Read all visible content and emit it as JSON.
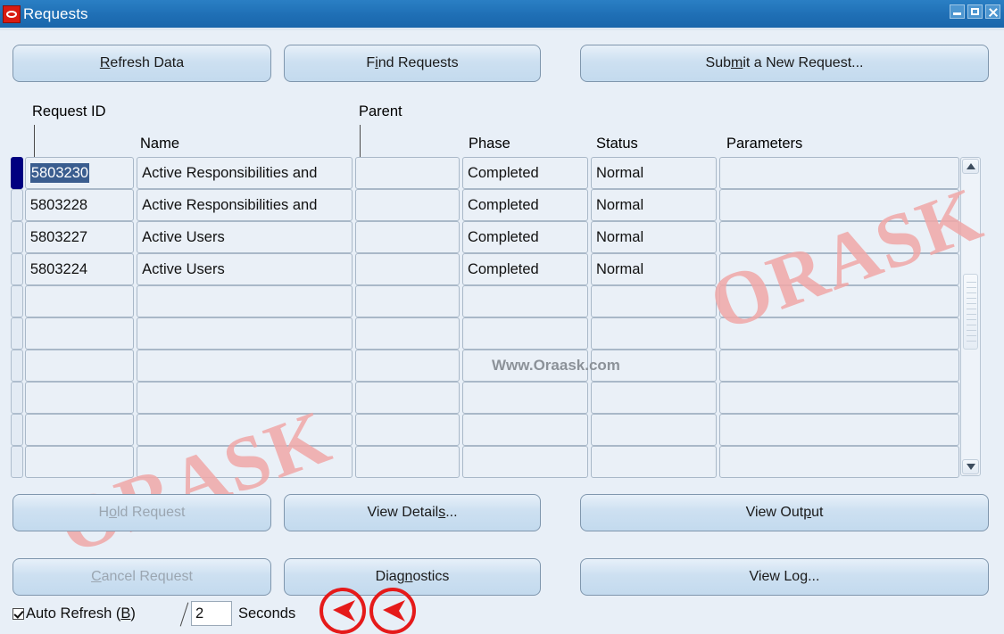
{
  "window": {
    "title": "Requests",
    "icon": "oracle-logo-icon",
    "controls": {
      "minimize": "minimize-icon",
      "maximize": "maximize-icon",
      "close": "close-icon"
    }
  },
  "toolbar": {
    "refresh_data": {
      "pre": "",
      "mnemonic": "R",
      "post": "efresh Data"
    },
    "find_requests": {
      "pre": "F",
      "mnemonic": "i",
      "post": "nd Requests"
    },
    "submit_new_request": {
      "pre": "Sub",
      "mnemonic": "m",
      "post": "it a New Request..."
    }
  },
  "grid": {
    "headers": {
      "request_id": "Request ID",
      "name": "Name",
      "parent": "Parent",
      "phase": "Phase",
      "status": "Status",
      "parameters": "Parameters"
    },
    "rows": [
      {
        "selected": true,
        "request_id": "5803230",
        "name": "Active Responsibilities and",
        "parent": "",
        "phase": "Completed",
        "status": "Normal",
        "parameters": ""
      },
      {
        "selected": false,
        "request_id": "5803228",
        "name": "Active Responsibilities and",
        "parent": "",
        "phase": "Completed",
        "status": "Normal",
        "parameters": ""
      },
      {
        "selected": false,
        "request_id": "5803227",
        "name": "Active Users",
        "parent": "",
        "phase": "Completed",
        "status": "Normal",
        "parameters": ""
      },
      {
        "selected": false,
        "request_id": "5803224",
        "name": "Active Users",
        "parent": "",
        "phase": "Completed",
        "status": "Normal",
        "parameters": ""
      },
      {
        "selected": false,
        "request_id": "",
        "name": "",
        "parent": "",
        "phase": "",
        "status": "",
        "parameters": ""
      },
      {
        "selected": false,
        "request_id": "",
        "name": "",
        "parent": "",
        "phase": "",
        "status": "",
        "parameters": ""
      },
      {
        "selected": false,
        "request_id": "",
        "name": "",
        "parent": "",
        "phase": "",
        "status": "",
        "parameters": ""
      },
      {
        "selected": false,
        "request_id": "",
        "name": "",
        "parent": "",
        "phase": "",
        "status": "",
        "parameters": ""
      },
      {
        "selected": false,
        "request_id": "",
        "name": "",
        "parent": "",
        "phase": "",
        "status": "",
        "parameters": ""
      },
      {
        "selected": false,
        "request_id": "",
        "name": "",
        "parent": "",
        "phase": "",
        "status": "",
        "parameters": ""
      }
    ]
  },
  "actions": {
    "hold_request": {
      "pre": "H",
      "mnemonic": "o",
      "post": "ld Request",
      "disabled": true
    },
    "view_details": {
      "pre": "View Detail",
      "mnemonic": "s",
      "post": "...",
      "disabled": false
    },
    "view_output": {
      "pre": "View Out",
      "mnemonic": "p",
      "post": "ut",
      "disabled": false
    },
    "cancel_request": {
      "pre": "",
      "mnemonic": "C",
      "post": "ancel Request",
      "disabled": true
    },
    "diagnostics": {
      "pre": "Diag",
      "mnemonic": "n",
      "post": "ostics",
      "disabled": false
    },
    "view_log": {
      "pre": "View Lo",
      "mnemonic": "g",
      "post": "...",
      "disabled": false
    }
  },
  "footer": {
    "auto_refresh": {
      "pre": "Auto Refresh (",
      "mnemonic": "B",
      "post": ")",
      "checked": true
    },
    "interval_value": "2",
    "interval_unit": "Seconds"
  },
  "annotations": {
    "arrow_one": "left-arrow-annotation",
    "arrow_two": "left-arrow-annotation",
    "color": "#e51a1a"
  },
  "watermarks": {
    "site_text": "Www.Oraask.com",
    "brand_text": "ORASK",
    "brand_color": "#f0a8a8"
  }
}
